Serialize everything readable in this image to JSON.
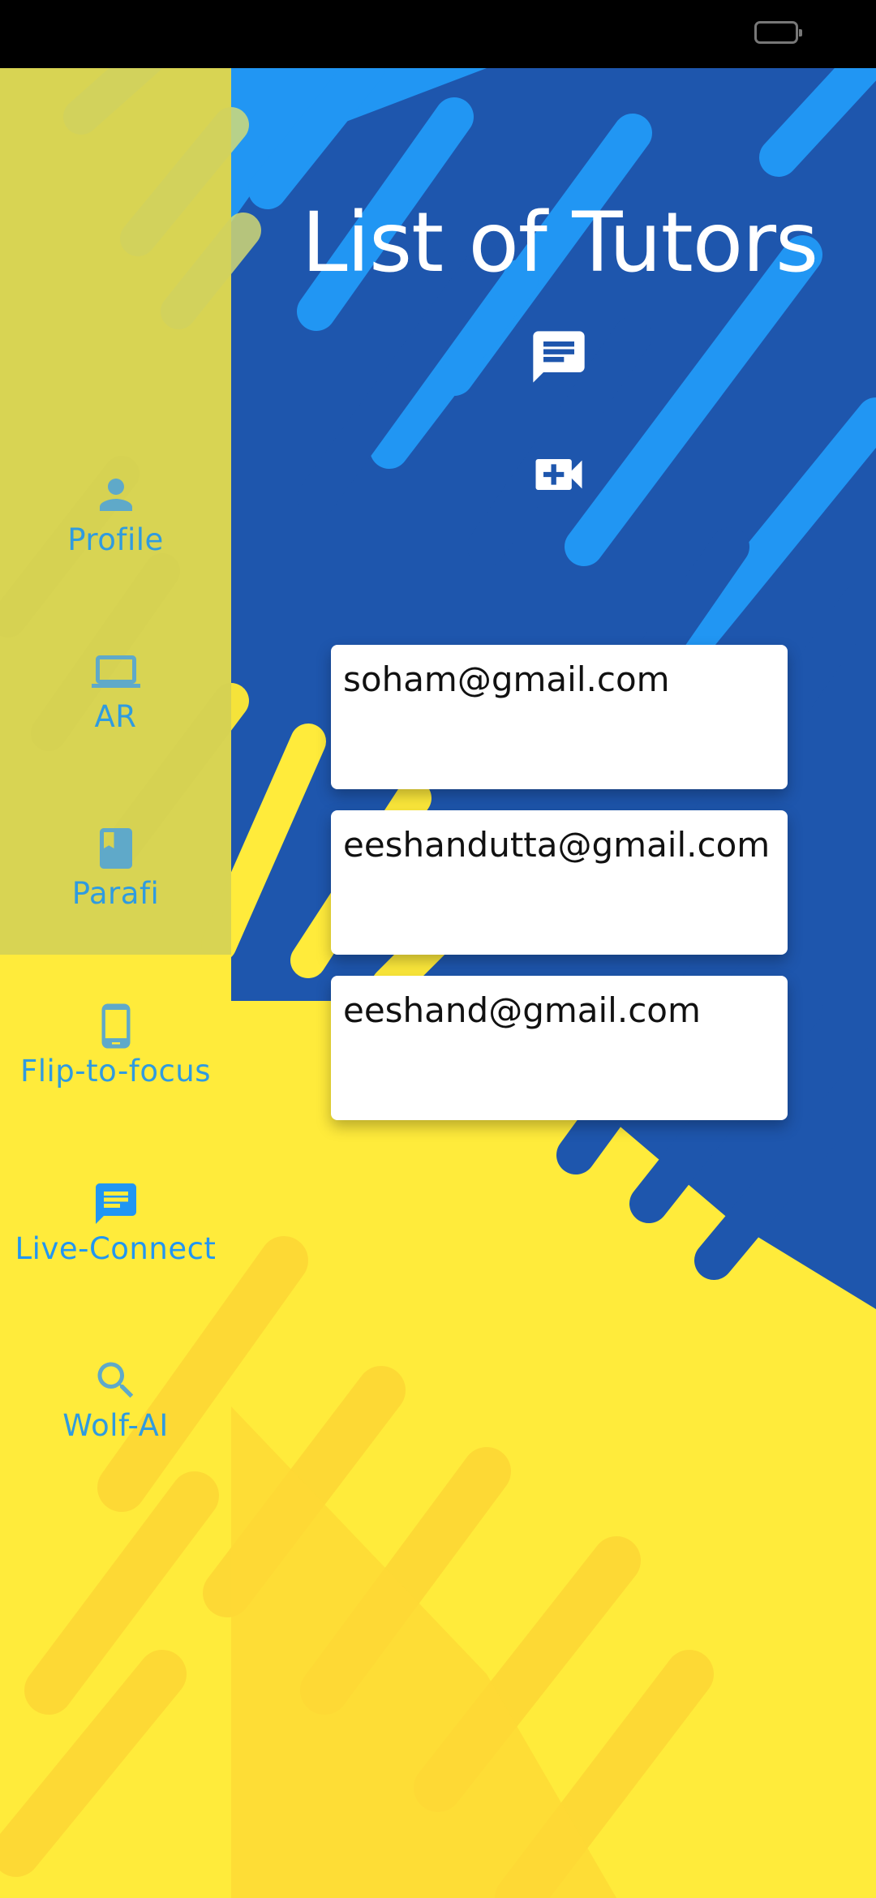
{
  "page": {
    "title": "List of Tutors"
  },
  "actions": {
    "chat_icon": "chat-bubble-icon",
    "video_icon": "video-call-add-icon"
  },
  "sidebar": {
    "items": [
      {
        "label": "Profile",
        "icon": "person-icon",
        "active": false
      },
      {
        "label": "AR",
        "icon": "laptop-icon",
        "active": false
      },
      {
        "label": "Parafi",
        "icon": "book-icon",
        "active": false
      },
      {
        "label": "Flip-to-focus",
        "icon": "phone-icon",
        "active": false
      },
      {
        "label": "Live-Connect",
        "icon": "chat-icon",
        "active": true
      },
      {
        "label": "Wolf-AI",
        "icon": "search-icon",
        "active": false
      }
    ]
  },
  "tutors": [
    {
      "email": "soham@gmail.com"
    },
    {
      "email": "eeshandutta@gmail.com"
    },
    {
      "email": "eeshand@gmail.com"
    }
  ],
  "colors": {
    "yellow": "#FFEB3B",
    "blue_light": "#2196F3",
    "blue_dark": "#1E56AD",
    "sidebar_label": "#2F9BE0",
    "sidebar_icon": "#5FA9C9"
  }
}
